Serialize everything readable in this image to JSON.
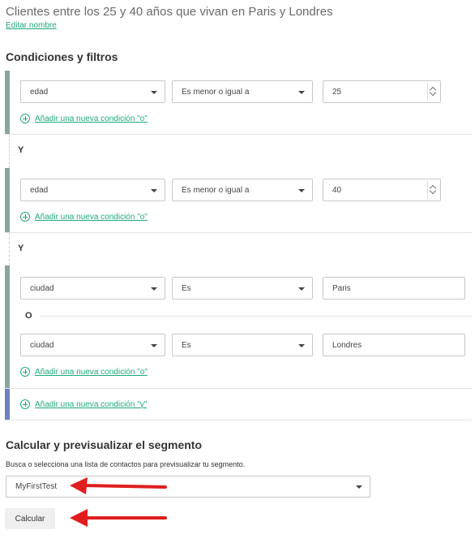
{
  "segment": {
    "title": "Clientes entre los 25 y 40 años que vivan en Paris y Londres",
    "edit_name_link": "Editar nombre"
  },
  "conditions": {
    "heading": "Condiciones y filtros",
    "connector_and": "Y",
    "connector_or": "O",
    "add_or_condition": "Añadir una nueva condición \"o\"",
    "add_and_condition": "Añadir una nueva condición \"y\"",
    "groups": [
      {
        "rows": [
          {
            "field": "edad",
            "operator": "Es menor o igual a",
            "value": "25"
          }
        ]
      },
      {
        "rows": [
          {
            "field": "edad",
            "operator": "Es menor o igual a",
            "value": "40"
          }
        ]
      },
      {
        "rows": [
          {
            "field": "ciudad",
            "operator": "Es",
            "value": "Paris"
          },
          {
            "field": "ciudad",
            "operator": "Es",
            "value": "Londres"
          }
        ]
      }
    ]
  },
  "preview": {
    "heading": "Calcular y previsualizar el segmento",
    "help_text": "Busca o selecciona una lista de contactos para previsualizar tu segmento.",
    "selected_list": "MyFirstTest",
    "calculate_button": "Calcular"
  },
  "colors": {
    "accent_green": "#1fa97c",
    "group_bar": "#8aa5a0",
    "and_bar": "#6b80c4",
    "annotation_arrow": "#e01e1e"
  }
}
